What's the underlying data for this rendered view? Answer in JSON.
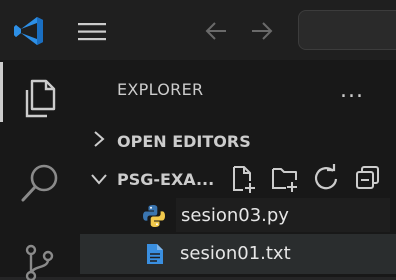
{
  "explorer": {
    "title": "EXPLORER",
    "more_actions": "...",
    "sections": {
      "open_editors": "OPEN EDITORS",
      "workspace": "PSG-EXA..."
    },
    "rename_value": "sesion03.py",
    "files": [
      {
        "name": "sesion01.txt",
        "icon": "text-file-icon"
      }
    ]
  },
  "colors": {
    "accent": "#2d8fe6",
    "python_blue": "#3a75b0",
    "python_yellow": "#f2c94c",
    "text": "#cccccc"
  }
}
